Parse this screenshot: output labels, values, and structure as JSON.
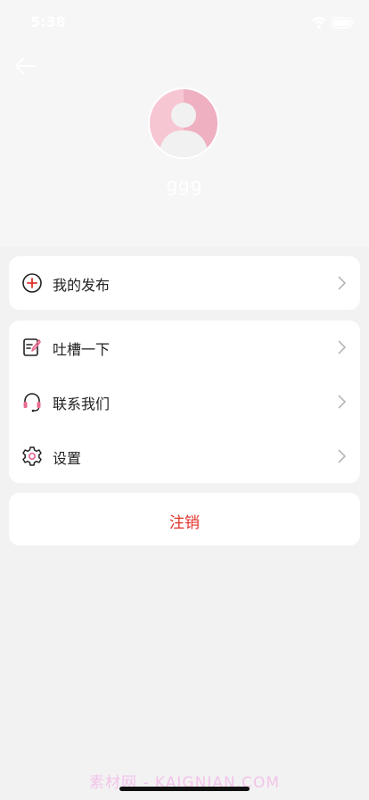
{
  "status_bar": {
    "time": "5:38"
  },
  "profile": {
    "username": "ggg"
  },
  "menu_group_1": [
    {
      "label": "我的发布",
      "icon": "add-circle-icon"
    }
  ],
  "menu_group_2": [
    {
      "label": "吐槽一下",
      "icon": "note-edit-icon"
    },
    {
      "label": "联系我们",
      "icon": "headset-icon"
    },
    {
      "label": "设置",
      "icon": "gear-icon"
    }
  ],
  "logout": {
    "label": "注销"
  },
  "watermark": {
    "text": "素材网 - KAIGNIAN.COM"
  },
  "colors": {
    "accent_red": "#e0332a",
    "avatar_pink": "#f3b3c4",
    "icon_pink": "#e96b8d",
    "background": "#f2f2f2"
  }
}
